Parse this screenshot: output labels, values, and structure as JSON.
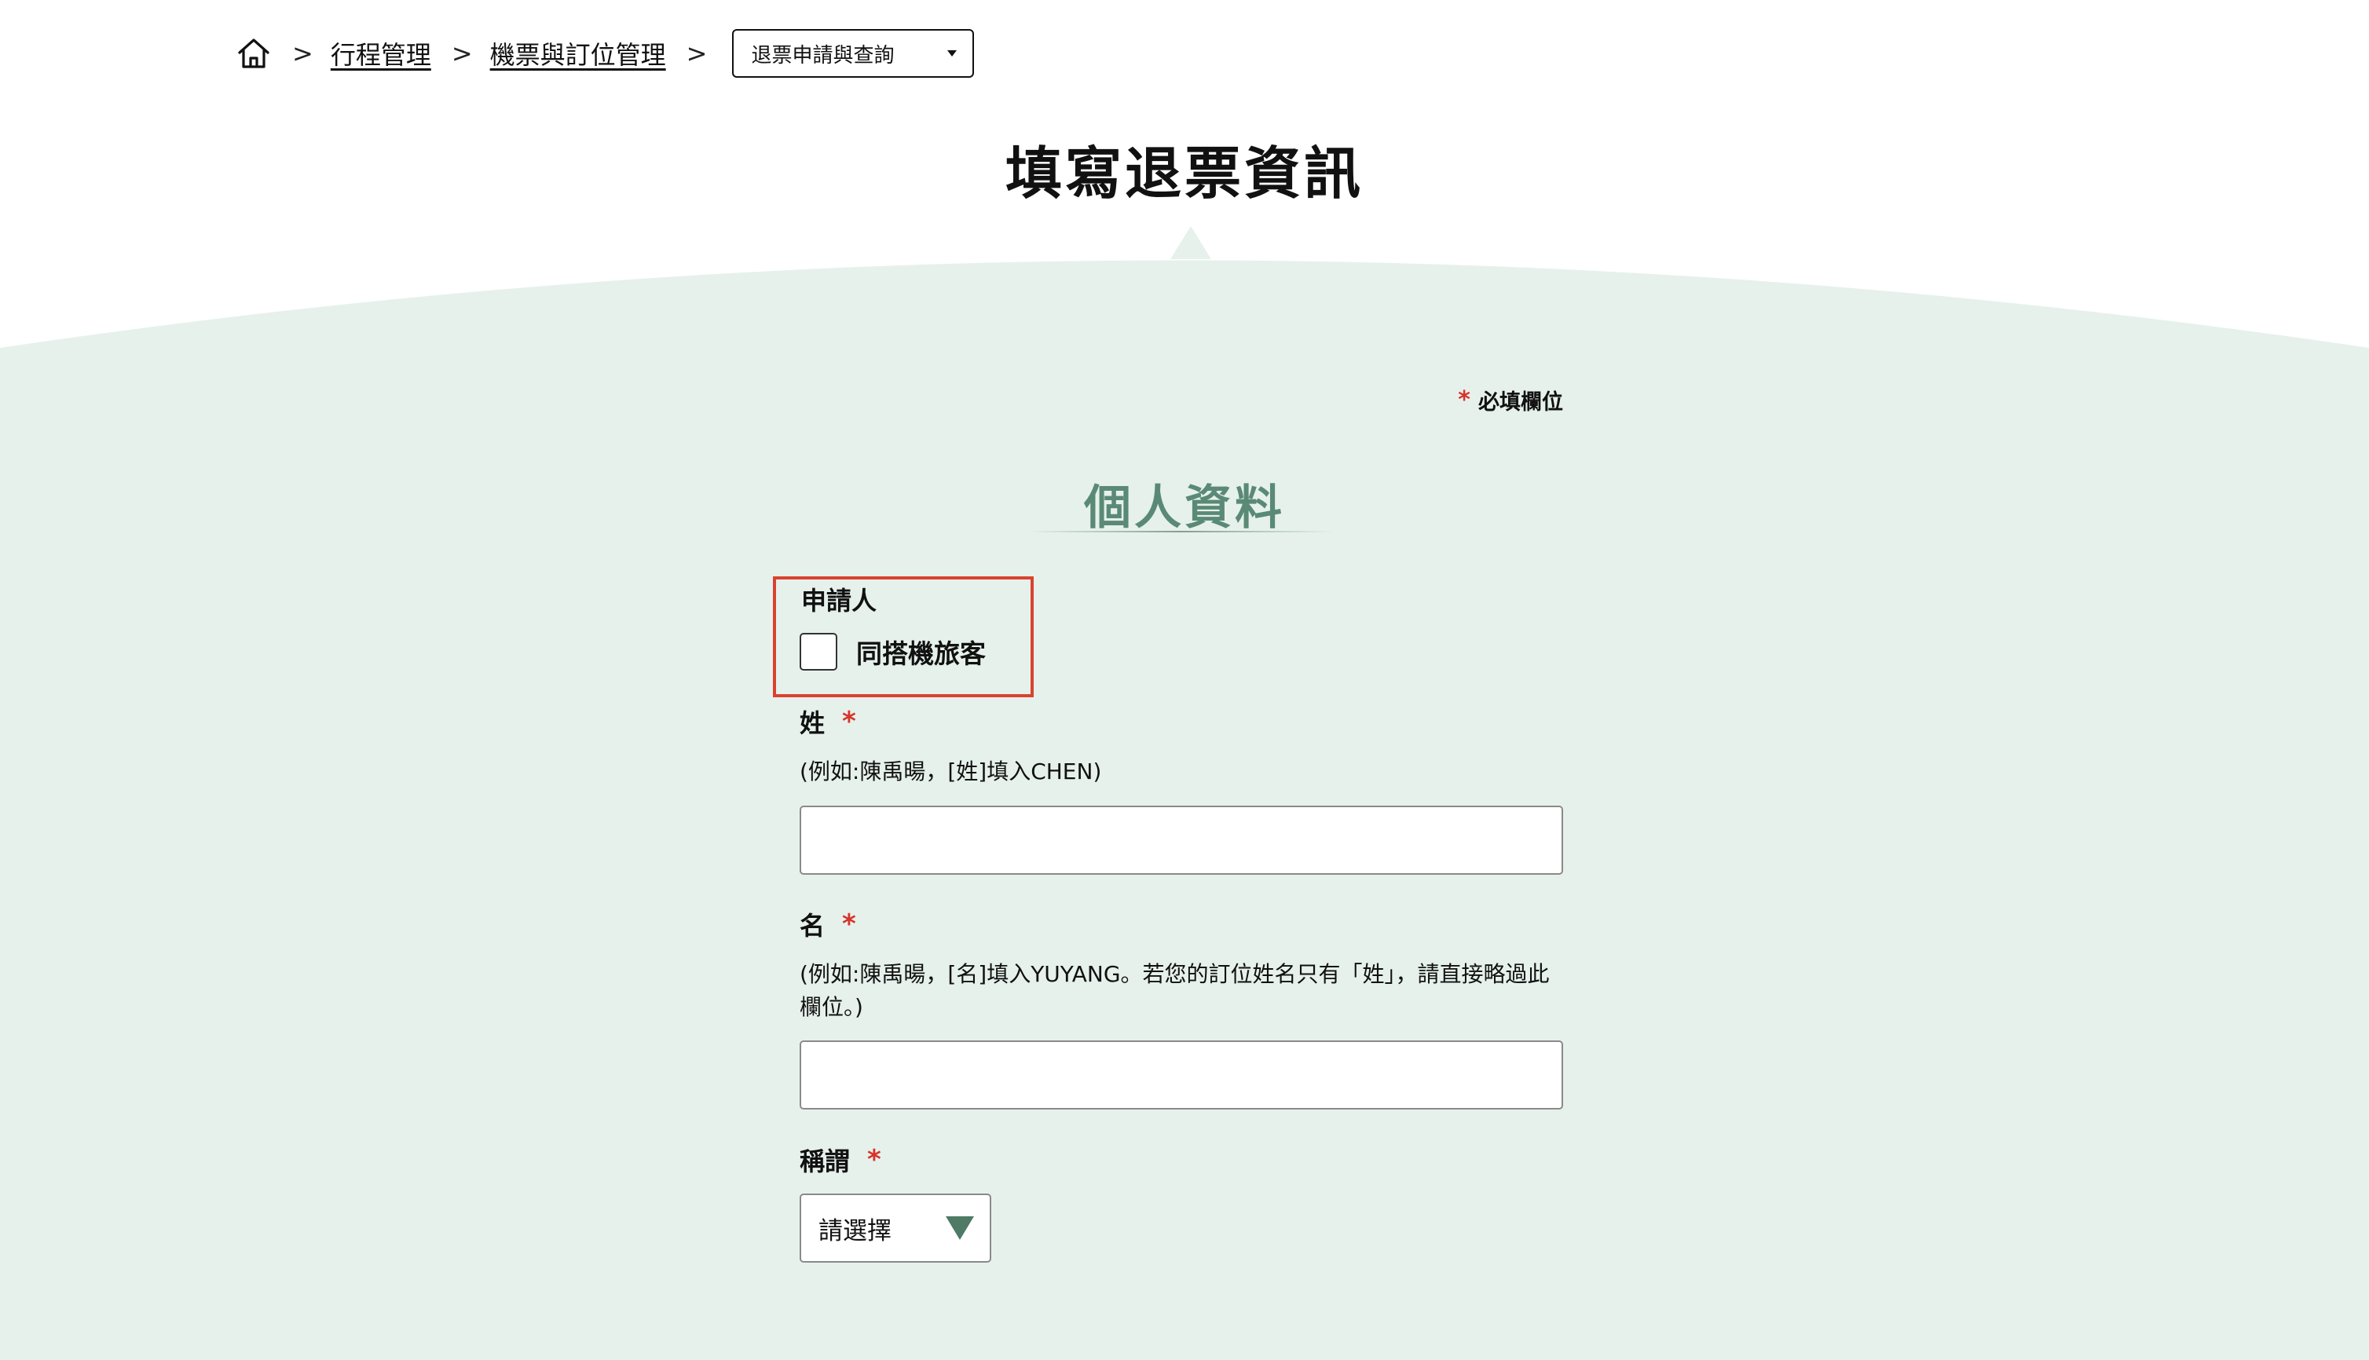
{
  "breadcrumb": {
    "home_icon": "home-icon",
    "separator": ">",
    "links": [
      "行程管理",
      "機票與訂位管理"
    ],
    "current_select": "退票申請與查詢"
  },
  "page_title": "填寫退票資訊",
  "required_note": {
    "star": "*",
    "label": "必填欄位"
  },
  "section_title": "個人資料",
  "applicant": {
    "label": "申請人",
    "checkbox_label": "同搭機旅客",
    "checked": false
  },
  "fields": {
    "surname": {
      "label": "姓",
      "star": "*",
      "hint": "(例如:陳禹暘，[姓]填入CHEN)",
      "value": ""
    },
    "given_name": {
      "label": "名",
      "star": "*",
      "hint": "(例如:陳禹暘，[名]填入YUYANG。若您的訂位姓名只有「姓」，請直接略過此欄位。)",
      "value": ""
    },
    "title": {
      "label": "稱謂",
      "star": "*",
      "selected": "請選擇"
    }
  },
  "colors": {
    "background_mint": "#e6f1ec",
    "accent_green": "#5a8a76",
    "required_red": "#d6342b",
    "highlight_box": "#d9432f"
  }
}
